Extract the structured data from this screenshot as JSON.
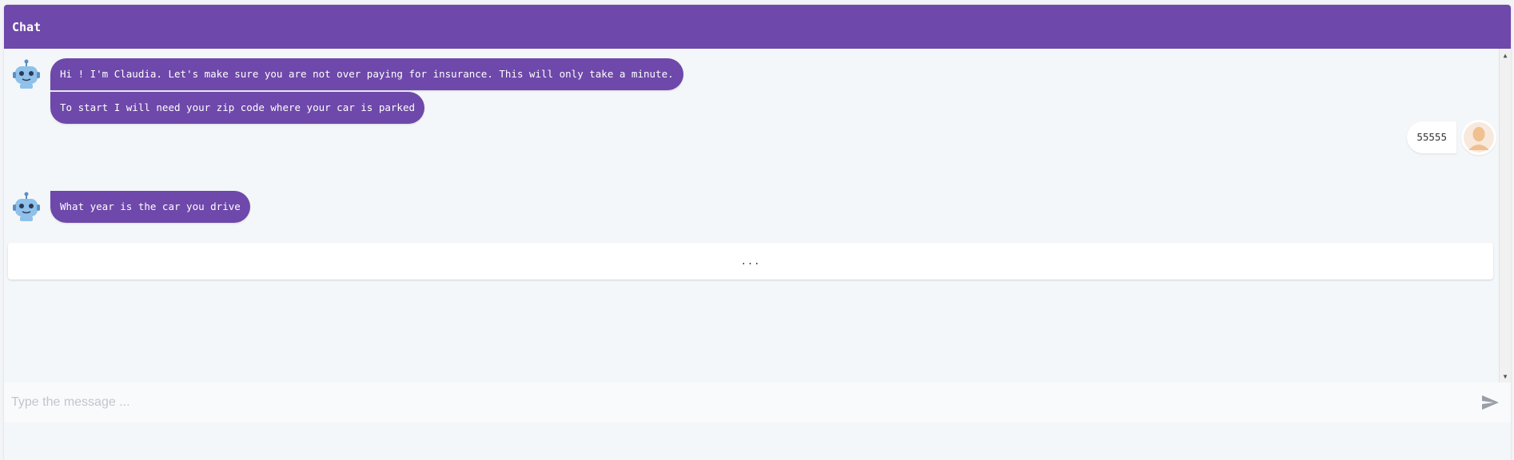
{
  "header": {
    "title": "Chat"
  },
  "messages": [
    {
      "sender": "bot",
      "texts": [
        "Hi ! I'm Claudia. Let's make sure you are not over paying for insurance. This will only take a minute.",
        "To start I will need your zip code where your car is parked"
      ]
    },
    {
      "sender": "user",
      "texts": [
        "55555"
      ]
    },
    {
      "sender": "bot",
      "texts": [
        "What year is the car you drive"
      ]
    }
  ],
  "typing_indicator": "...",
  "composer": {
    "placeholder": "Type the message ..."
  },
  "icons": {
    "bot_avatar": "robot-icon",
    "user_avatar": "user-avatar-icon",
    "send": "send-icon"
  },
  "colors": {
    "accent": "#6e48aa",
    "background": "#f4f7f9",
    "bubble_text": "#ffffff"
  }
}
